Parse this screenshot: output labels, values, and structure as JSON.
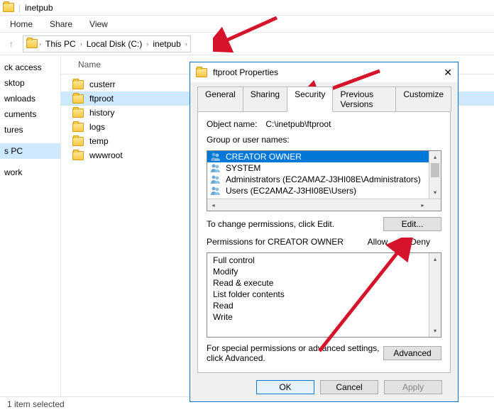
{
  "titlebar": {
    "name": "inetpub"
  },
  "ribbon": {
    "tabs": [
      "Home",
      "Share",
      "View"
    ]
  },
  "breadcrumbs": [
    "This PC",
    "Local Disk (C:)",
    "inetpub"
  ],
  "column_header": "Name",
  "files": [
    {
      "name": "custerr"
    },
    {
      "name": "ftproot",
      "selected": true
    },
    {
      "name": "history"
    },
    {
      "name": "logs"
    },
    {
      "name": "temp"
    },
    {
      "name": "wwwroot"
    }
  ],
  "sidebar": {
    "items": [
      "ck access",
      "sktop",
      "wnloads",
      "cuments",
      "tures",
      "",
      "s PC",
      "",
      "work"
    ]
  },
  "status": "1 item selected",
  "dialog": {
    "title": "ftproot Properties",
    "tabs": [
      "General",
      "Sharing",
      "Security",
      "Previous Versions",
      "Customize"
    ],
    "active_tab": "Security",
    "object_label": "Object name:",
    "object_path": "C:\\inetpub\\ftproot",
    "group_label": "Group or user names:",
    "groups": [
      {
        "name": "CREATOR OWNER",
        "selected": true
      },
      {
        "name": "SYSTEM"
      },
      {
        "name": "Administrators (EC2AMAZ-J3HI08E\\Administrators)"
      },
      {
        "name": "Users (EC2AMAZ-J3HI08E\\Users)"
      }
    ],
    "change_text": "To change permissions, click Edit.",
    "edit_btn": "Edit...",
    "perm_label": "Permissions for CREATOR OWNER",
    "perm_cols": {
      "allow": "Allow",
      "deny": "Deny"
    },
    "permissions": [
      "Full control",
      "Modify",
      "Read & execute",
      "List folder contents",
      "Read",
      "Write"
    ],
    "advanced_text": "For special permissions or advanced settings, click Advanced.",
    "advanced_btn": "Advanced",
    "buttons": {
      "ok": "OK",
      "cancel": "Cancel",
      "apply": "Apply"
    }
  }
}
